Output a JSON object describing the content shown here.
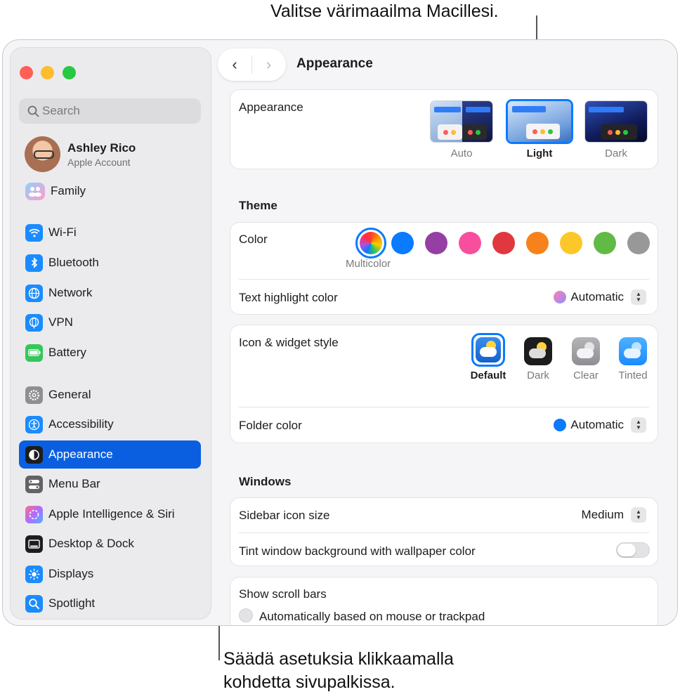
{
  "callouts": {
    "top": "Valitse värimaailma Macillesi.",
    "bottom_line1": "Säädä asetuksia klikkaamalla",
    "bottom_line2": "kohdetta sivupalkissa."
  },
  "sidebar": {
    "search_placeholder": "Search",
    "user": {
      "name": "Ashley Rico",
      "subtitle": "Apple Account"
    },
    "family_label": "Family",
    "items": [
      {
        "label": "Wi-Fi",
        "icon": "wifi-icon",
        "color": "#1a8cff"
      },
      {
        "label": "Bluetooth",
        "icon": "bluetooth-icon",
        "color": "#1a8cff"
      },
      {
        "label": "Network",
        "icon": "globe-icon",
        "color": "#1a8cff"
      },
      {
        "label": "VPN",
        "icon": "vpn-globe-icon",
        "color": "#1a8cff"
      },
      {
        "label": "Battery",
        "icon": "battery-icon",
        "color": "#34c759"
      },
      {
        "label": "General",
        "icon": "gear-icon",
        "color": "#8e8e93"
      },
      {
        "label": "Accessibility",
        "icon": "accessibility-icon",
        "color": "#1a8cff"
      },
      {
        "label": "Appearance",
        "icon": "appearance-icon",
        "color": "#1d1d1f",
        "active": true
      },
      {
        "label": "Menu Bar",
        "icon": "menubar-icon",
        "color": "#636366"
      },
      {
        "label": "Apple Intelligence & Siri",
        "icon": "siri-icon",
        "color": "#c86dd7"
      },
      {
        "label": "Desktop & Dock",
        "icon": "dock-icon",
        "color": "#1d1d1f"
      },
      {
        "label": "Displays",
        "icon": "sun-icon",
        "color": "#1a8cff"
      },
      {
        "label": "Spotlight",
        "icon": "magnifier-icon",
        "color": "#1a8cff"
      }
    ]
  },
  "header": {
    "title": "Appearance",
    "back": "‹",
    "forward": "›"
  },
  "appearance": {
    "label": "Appearance",
    "options": [
      "Auto",
      "Light",
      "Dark"
    ],
    "selected": "Light"
  },
  "theme": {
    "heading": "Theme",
    "color_label": "Color",
    "selected_caption": "Multicolor",
    "colors": [
      "multicolor",
      "#0a7aff",
      "#953ea3",
      "#f74f9e",
      "#e0383e",
      "#f7821b",
      "#fcc728",
      "#62ba46",
      "#989898"
    ],
    "highlight_label": "Text highlight color",
    "highlight_value": "Automatic"
  },
  "icons": {
    "label": "Icon & widget style",
    "options": [
      "Default",
      "Dark",
      "Clear",
      "Tinted"
    ],
    "selected": "Default",
    "folder_label": "Folder color",
    "folder_value": "Automatic"
  },
  "windows": {
    "heading": "Windows",
    "sidebar_icon_label": "Sidebar icon size",
    "sidebar_icon_value": "Medium",
    "tint_label": "Tint window background with wallpaper color",
    "tint_on": false,
    "scroll_label": "Show scroll bars",
    "scroll_option": "Automatically based on mouse or trackpad"
  }
}
